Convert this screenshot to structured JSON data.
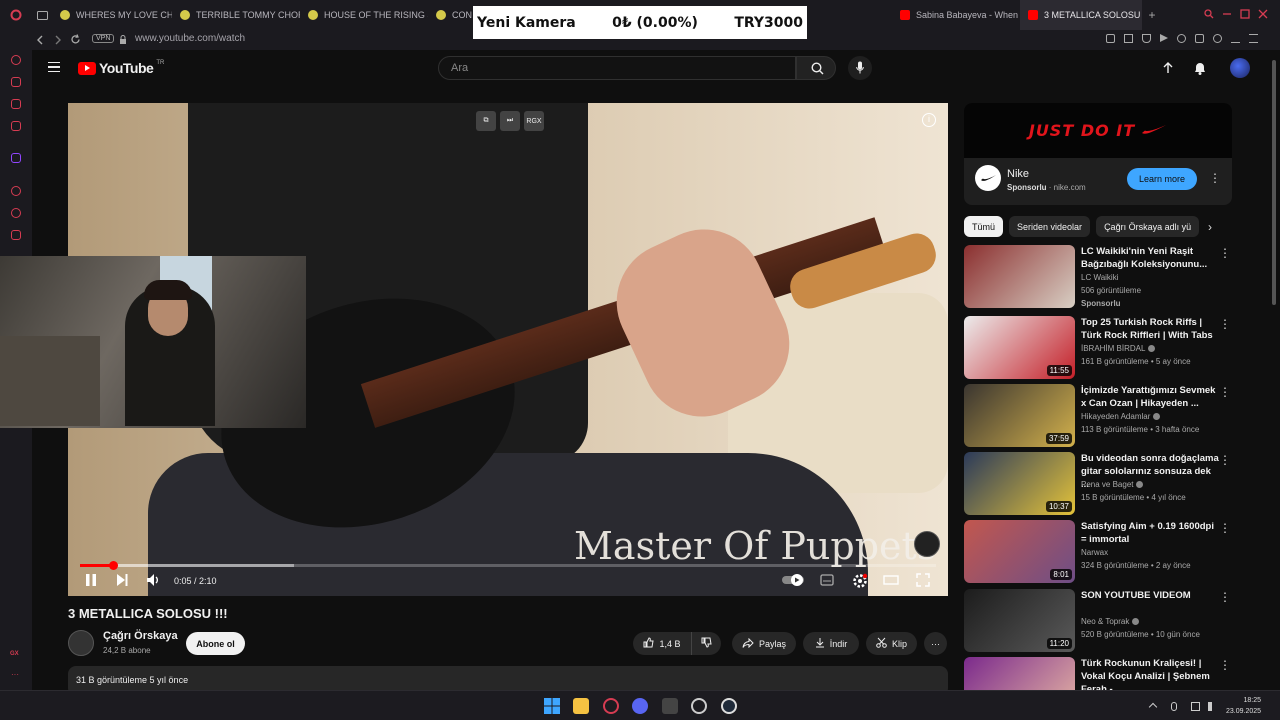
{
  "browser": {
    "tabs": [
      {
        "label": "WHERES MY LOVE CHOR",
        "color": "#d4c94a"
      },
      {
        "label": "TERRIBLE TOMMY CHOR",
        "color": "#d4c94a"
      },
      {
        "label": "HOUSE OF THE RISING S",
        "color": "#d4c94a"
      },
      {
        "label": "CON",
        "color": "#d4c94a"
      },
      {
        "label": "Sabina Babayeva - When",
        "color": "#ff0000"
      },
      {
        "label": "3 METALLICA SOLOSU",
        "color": "#ff0000"
      }
    ],
    "url": "www.youtube.com/watch",
    "vpn_label": "VPN",
    "new_tab": "+"
  },
  "overlay": {
    "name": "Yeni Kamera",
    "change": "0₺ (0.00%)",
    "price": "TRY3000"
  },
  "header": {
    "logo_text": "YouTube",
    "region": "TR",
    "search_placeholder": "Ara"
  },
  "player": {
    "watermark": "Master Of Puppets",
    "ext_label": "RGX",
    "time": "0:05 / 2:10",
    "progress": 0.038,
    "buffered": 0.25
  },
  "video": {
    "title": "3 METALLICA SOLOSU !!!",
    "channel": "Çağrı Örskaya",
    "subscribers": "24,2 B abone",
    "subscribe_label": "Abone ol",
    "likes": "1,4 B",
    "share_label": "Paylaş",
    "download_label": "İndir",
    "clip_label": "Klip",
    "views_date": "31 B görüntüleme  5 yıl önce"
  },
  "ad": {
    "banner_text": "JUST DO IT",
    "advertiser": "Nike",
    "sponsored": "Sponsorlu",
    "domain": "nike.com",
    "cta": "Learn more"
  },
  "chips": [
    "Tümü",
    "Seriden videolar",
    "Çağrı Örskaya adlı yü"
  ],
  "recommendations": [
    {
      "title": "LC Waikiki'nin Yeni Raşit Bağzıbağlı Koleksiyonunu...",
      "channel": "LC Waikiki",
      "views": "506 görüntüleme",
      "extra": "Sponsorlu",
      "duration": "",
      "colors": [
        "#8b2f2f",
        "#d8cfc4"
      ]
    },
    {
      "title": "Top 25 Turkish Rock Riffs | Türk Rock Riffleri | With Tabs",
      "channel": "İBRAHİM BİRDAL",
      "views": "161 B görüntüleme • 5 ay önce",
      "extra": "",
      "duration": "11:55",
      "colors": [
        "#ececec",
        "#c41f28"
      ]
    },
    {
      "title": "İçimizde Yarattığımızı Sevmek x Can Ozan | Hikayeden ...",
      "channel": "Hikayeden Adamlar",
      "views": "113 B görüntüleme • 3 hafta önce",
      "extra": "",
      "duration": "37:59",
      "colors": [
        "#3a3530",
        "#d3b14c"
      ]
    },
    {
      "title": "Bu videodan sonra doğaçlama gitar sololarınız sonsuza dek ...",
      "channel": "Pena ve Baget",
      "views": "15 B görüntüleme • 4 yıl önce",
      "extra": "",
      "duration": "10:37",
      "colors": [
        "#2b3a5a",
        "#e4c33a"
      ]
    },
    {
      "title": "Satisfying Aim + 0.19 1600dpi = immortal",
      "channel": "Narwax",
      "views": "324 B görüntüleme • 2 ay önce",
      "extra": "",
      "duration": "8:01",
      "colors": [
        "#c2574e",
        "#6e4e86"
      ]
    },
    {
      "title": "SON YOUTUBE VIDEOM",
      "channel": "Neo & Toprak",
      "views": "520 B görüntüleme • 10 gün önce",
      "extra": "",
      "duration": "11:20",
      "colors": [
        "#1c1c1c",
        "#5a5a5a"
      ]
    },
    {
      "title": "Türk Rockunun Kraliçesi! | Vokal Koçu Analizi | Şebnem Ferah - ...",
      "channel": "",
      "views": "",
      "extra": "",
      "duration": "",
      "colors": [
        "#7b2a8c",
        "#e8b8a4"
      ]
    }
  ],
  "taskbar": {
    "time": "18:25",
    "date": "23.09.2025"
  },
  "icons": [
    "hamburger-icon",
    "search-icon",
    "mic-icon",
    "upload-icon",
    "bell-icon",
    "play-icon",
    "next-icon",
    "volume-icon",
    "settings-icon",
    "fullscreen-icon",
    "like-icon",
    "dislike-icon",
    "share-icon",
    "download-icon",
    "clip-icon",
    "more-icon"
  ]
}
